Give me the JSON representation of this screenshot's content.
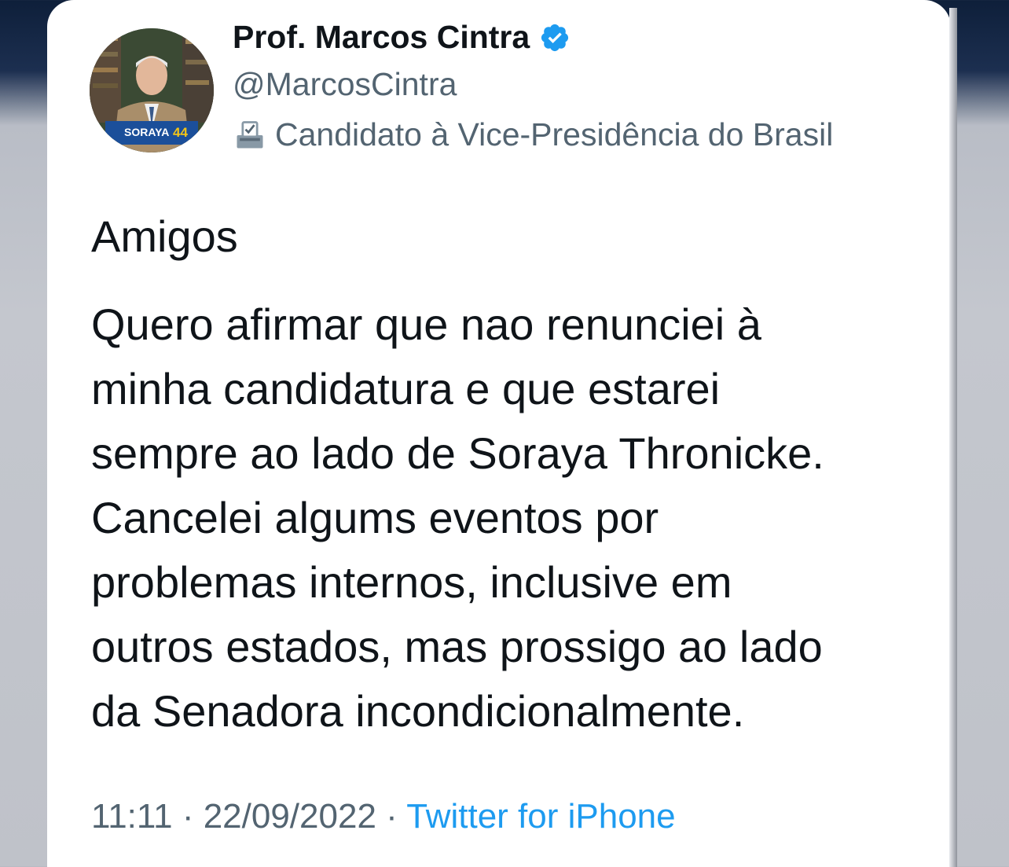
{
  "tweet": {
    "author": {
      "display_name": "Prof. Marcos Cintra",
      "handle": "@MarcosCintra",
      "bio": "Candidato à Vice-Presidência do Brasil",
      "bio_icon": "ballot-box-icon",
      "verified_icon": "verified-badge-icon",
      "avatar_badge_text": "SORAYA44"
    },
    "greeting": "Amigos",
    "body": "Quero afirmar que nao renunciei à\nminha candidatura e que estarei\nsempre ao lado de Soraya Thronicke.\nCancelei algums eventos por\nproblemas internos, inclusive em\noutros estados, mas prossigo ao lado\nda Senadora incondicionalmente.",
    "time": "11:11",
    "separator": "·",
    "date": "22/09/2022",
    "source": "Twitter for iPhone"
  },
  "colors": {
    "verified": "#1d9bf0",
    "text": "#0f1419",
    "secondary": "#536471",
    "link": "#1d9bf0"
  }
}
